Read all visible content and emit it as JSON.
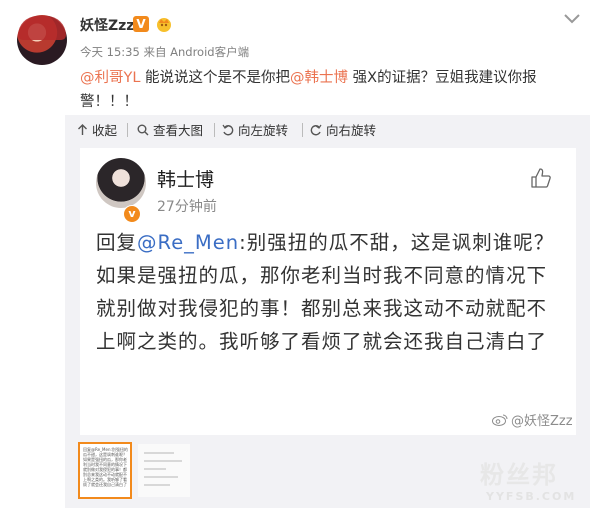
{
  "post": {
    "username": "妖怪Zzz",
    "verified_badge": "V",
    "time": "今天 15:35",
    "source": "来自 Android客户端",
    "mention1": "@利哥YL",
    "text_part1": "能说说这个是不是你把",
    "mention2": "@韩士博",
    "text_part2": "强X的证据？豆姐我建议你报警！！！"
  },
  "toolbar": {
    "collapse_label": "收起",
    "view_large_label": "查看大图",
    "rotate_left_label": "向左旋转",
    "rotate_right_label": "向右旋转"
  },
  "inner_card": {
    "name": "韩士博",
    "time": "27分钟前",
    "verified_badge": "v",
    "reply_prefix": "回复",
    "mention": "@Re_Men",
    "reply_text": ":别强扭的瓜不甜，这是讽刺谁呢？如果是强扭的瓜，那你老利当时我不同意的情况下就别做对我侵犯的事！都别总来我这动不动就配不上啊之类的。我听够了看烦了就会还我自己清白了"
  },
  "watermark": "@妖怪Zzz",
  "thumbnail_text": "回复@Re_Men:别强扭的瓜不甜，这是讽刺谁呢？如果是强扭的瓜，那你老利当时我不同意的情况下就别做对我侵犯的事！都别总来我这动不动就配不上啊之类的。我听够了看烦了就会还我自己清白了",
  "brand": {
    "name": "粉丝邦",
    "url": "YYFSB.COM"
  },
  "colors": {
    "mention": "#eb7350",
    "inner_mention": "#3a6dc4",
    "badge_orange": "#f28a1c",
    "viewer_bg": "#f2f2f5"
  },
  "icons": [
    "avatar",
    "verified-icon",
    "crown-icon",
    "chevron-down-icon",
    "collapse-icon",
    "magnifier-icon",
    "rotate-left-icon",
    "rotate-right-icon",
    "thumbs-up-icon",
    "weibo-icon"
  ]
}
